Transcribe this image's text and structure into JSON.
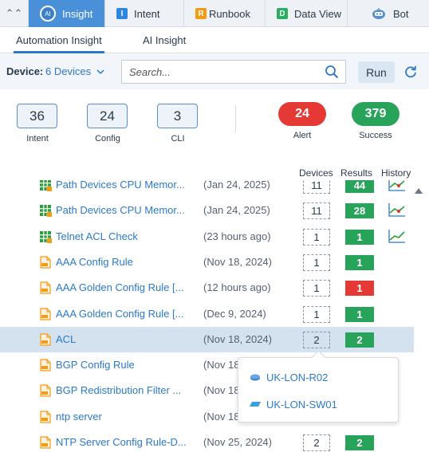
{
  "top_tabs": [
    {
      "label": "Insight",
      "icon": "insight-ai-icon"
    },
    {
      "label": "Intent",
      "icon": "intent-icon",
      "badge": "I",
      "color": "#2e86de"
    },
    {
      "label": "Runbook",
      "icon": "runbook-icon",
      "badge": "R",
      "color": "#f39c12"
    },
    {
      "label": "Data View",
      "icon": "data-view-icon",
      "badge": "D",
      "color": "#27ae60"
    },
    {
      "label": "Bot",
      "icon": "bot-icon"
    }
  ],
  "sub_tabs": [
    {
      "label": "Automation Insight",
      "active": true
    },
    {
      "label": "AI Insight",
      "active": false
    }
  ],
  "device": {
    "label": "Device:",
    "selected": "6 Devices"
  },
  "search": {
    "placeholder": "Search..."
  },
  "run_label": "Run",
  "stats": [
    {
      "value": "36",
      "label": "Intent"
    },
    {
      "value": "24",
      "label": "Config"
    },
    {
      "value": "3",
      "label": "CLI"
    }
  ],
  "summary": [
    {
      "value": "24",
      "label": "Alert",
      "color": "#e53935"
    },
    {
      "value": "379",
      "label": "Success",
      "color": "#27a35a"
    }
  ],
  "columns": {
    "devices": "Devices",
    "results": "Results",
    "history": "History"
  },
  "rows": [
    {
      "name": "Path Devices CPU Memor...",
      "time": "(Jan 24, 2025)",
      "devices": "11",
      "result": "44",
      "status": "success",
      "icon": "grid-icon",
      "history": "alert-trend"
    },
    {
      "name": "Path Devices CPU Memor...",
      "time": "(Jan 24, 2025)",
      "devices": "11",
      "result": "28",
      "status": "success",
      "icon": "grid-icon",
      "history": "alert-trend"
    },
    {
      "name": "Telnet ACL Check",
      "time": "(23 hours ago)",
      "devices": "1",
      "result": "1",
      "status": "success",
      "icon": "grid-icon",
      "history": "success-trend"
    },
    {
      "name": "AAA Config Rule",
      "time": "(Nov 18, 2024)",
      "devices": "1",
      "result": "1",
      "status": "success",
      "icon": "config-file-icon"
    },
    {
      "name": "AAA Golden Config Rule [...",
      "time": "(12 hours ago)",
      "devices": "1",
      "result": "1",
      "status": "alert",
      "icon": "config-file-icon"
    },
    {
      "name": "AAA Golden Config Rule [...",
      "time": "(Dec 9, 2024)",
      "devices": "1",
      "result": "1",
      "status": "success",
      "icon": "config-file-icon"
    },
    {
      "name": "ACL",
      "time": "(Nov 18, 2024)",
      "devices": "2",
      "result": "2",
      "status": "success",
      "icon": "config-file-icon",
      "selected": true
    },
    {
      "name": "BGP Config Rule",
      "time": "(Nov 18",
      "devices": "",
      "result": "",
      "status": "",
      "icon": "config-file-icon"
    },
    {
      "name": "BGP Redistribution Filter ...",
      "time": "(Nov 18",
      "devices": "",
      "result": "",
      "status": "",
      "icon": "config-file-icon"
    },
    {
      "name": "ntp server",
      "time": "(Nov 18",
      "devices": "",
      "result": "",
      "status": "",
      "icon": "config-file-icon"
    },
    {
      "name": "NTP Server Config Rule-D...",
      "time": "(Nov 25, 2024)",
      "devices": "2",
      "result": "2",
      "status": "success",
      "icon": "config-file-icon"
    }
  ],
  "popup": [
    {
      "label": "UK-LON-R02",
      "icon": "router-icon"
    },
    {
      "label": "UK-LON-SW01",
      "icon": "switch-icon"
    }
  ],
  "colors": {
    "accent": "#4a90d9",
    "link": "#2b79c9",
    "success": "#27a35a",
    "alert": "#e53935",
    "selected_row": "#d4e1ee"
  }
}
